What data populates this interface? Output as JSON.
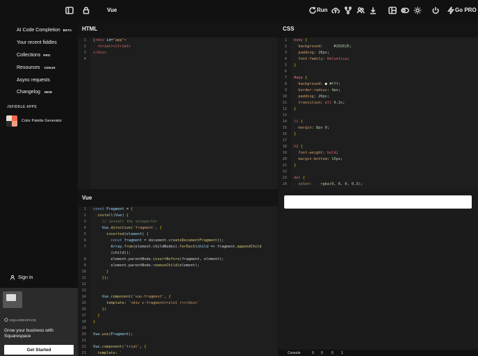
{
  "topbar": {
    "project_name": "Vue",
    "run_label": "Run",
    "go_pro_label": "Go PRO"
  },
  "sidebar": {
    "items": [
      {
        "label": "AI Code Completion",
        "badge": "BETA"
      },
      {
        "label": "Your recent fiddles",
        "badge": ""
      },
      {
        "label": "Collections",
        "badge": "PRO"
      },
      {
        "label": "Resources",
        "badge": "CDNJS"
      },
      {
        "label": "Async requests",
        "badge": ""
      },
      {
        "label": "Changelog",
        "badge": "NEW"
      }
    ],
    "section_title": "JSFIDDLE APPS",
    "app": {
      "name": "Color Palette Generator"
    },
    "signin_label": "Sign in",
    "ad": {
      "brand": "SQUARESPACE",
      "text": "Grow your business with Squarespace",
      "button": "Get Started"
    }
  },
  "panels": {
    "html_title": "HTML",
    "css_title": "CSS",
    "js_title": "Vue"
  },
  "html_lines": [
    "1",
    "2",
    "3",
    "4"
  ],
  "css_lines": [
    "1",
    "2",
    "3",
    "4",
    "5",
    "6",
    "7",
    "8",
    "9",
    "10",
    "11",
    "12",
    "13",
    "14",
    "15",
    "16",
    "17",
    "18",
    "19",
    "20",
    "21",
    "22",
    "23",
    "24"
  ],
  "js_lines": [
    "1",
    "2",
    "3",
    "4",
    "5",
    "6",
    "7",
    "",
    "8",
    "9",
    "10",
    "11",
    "12",
    "13",
    "14",
    "15",
    "16",
    "17",
    "18",
    "19",
    "20",
    "21",
    "22",
    "23"
  ],
  "console": {
    "label": "Console",
    "counts": [
      "0",
      "0",
      "0",
      "1"
    ]
  },
  "colors": {
    "accent": "#f0c000",
    "swatch": [
      "#e8e0d6",
      "#f26b4b",
      "#2b2b2b",
      "#f0a080"
    ]
  }
}
